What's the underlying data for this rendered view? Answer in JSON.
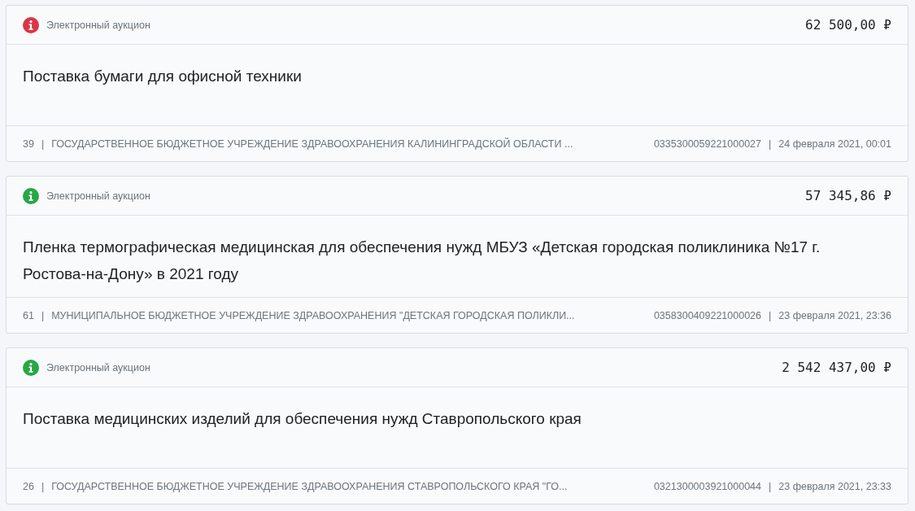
{
  "lots": [
    {
      "color": "#dc3545",
      "procedure": "Электронный аукцион",
      "price": "62 500,00 ₽",
      "title": "Поставка бумаги для офисной техники",
      "number": "39",
      "separator": "|",
      "organization": "ГОСУДАРСТВЕННОЕ БЮДЖЕТНОЕ УЧРЕЖДЕНИЕ ЗДРАВООХРАНЕНИЯ КАЛИНИНГРАДСКОЙ ОБЛАСТИ ...",
      "registry_number": "0335300059221000027",
      "date_separator": "|",
      "published": "24 февраля 2021, 00:01"
    },
    {
      "color": "#28a745",
      "procedure": "Электронный аукцион",
      "price": "57 345,86 ₽",
      "title": "Пленка термографическая медицинская для обеспечения нужд МБУЗ «Детская городская поликлиника №17 г. Ростова-на-Дону» в 2021 году",
      "number": "61",
      "separator": "|",
      "organization": "МУНИЦИПАЛЬНОЕ БЮДЖЕТНОЕ УЧРЕЖДЕНИЕ ЗДРАВООХРАНЕНИЯ \"ДЕТСКАЯ ГОРОДСКАЯ ПОЛИКЛИ...",
      "registry_number": "0358300409221000026",
      "date_separator": "|",
      "published": "23 февраля 2021, 23:36"
    },
    {
      "color": "#28a745",
      "procedure": "Электронный аукцион",
      "price": "2 542 437,00 ₽",
      "title": "Поставка медицинских изделий для обеспечения нужд Ставропольского края",
      "number": "26",
      "separator": "|",
      "organization": "ГОСУДАРСТВЕННОЕ БЮДЖЕТНОЕ УЧРЕЖДЕНИЕ ЗДРАВООХРАНЕНИЯ СТАВРОПОЛЬСКОГО КРАЯ \"ГО...",
      "registry_number": "0321300003921000044",
      "date_separator": "|",
      "published": "23 февраля 2021, 23:33"
    }
  ]
}
